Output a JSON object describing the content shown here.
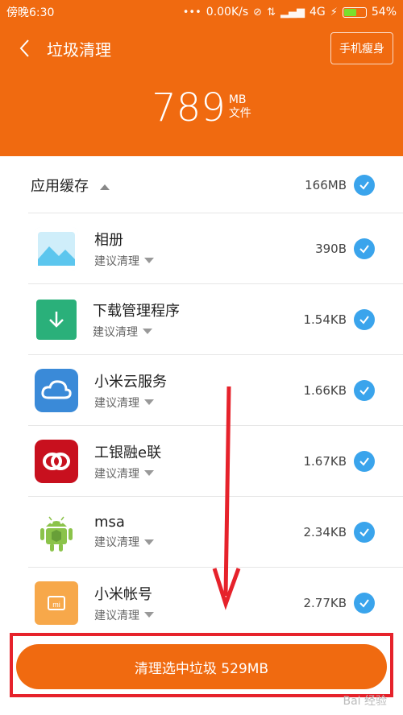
{
  "statusbar": {
    "time": "傍晚6:30",
    "network_speed": "0.00K/s",
    "signal_label": "4G",
    "battery_pct": "54%"
  },
  "nav": {
    "title": "垃圾清理",
    "slim_button": "手机瘦身"
  },
  "summary": {
    "total": "789",
    "unit": "MB",
    "unit_sub": "文件"
  },
  "group": {
    "label": "应用缓存",
    "size": "166MB"
  },
  "apps": [
    {
      "name": "相册",
      "sub": "建议清理",
      "size": "390B",
      "icon": "gallery-icon"
    },
    {
      "name": "下载管理程序",
      "sub": "建议清理",
      "size": "1.54KB",
      "icon": "download-icon"
    },
    {
      "name": "小米云服务",
      "sub": "建议清理",
      "size": "1.66KB",
      "icon": "cloud-icon"
    },
    {
      "name": "工银融e联",
      "sub": "建议清理",
      "size": "1.67KB",
      "icon": "icbc-icon"
    },
    {
      "name": "msa",
      "sub": "建议清理",
      "size": "2.34KB",
      "icon": "android-icon"
    },
    {
      "name": "小米帐号",
      "sub": "建议清理",
      "size": "2.77KB",
      "icon": "mi-account-icon"
    }
  ],
  "footer": {
    "clean_button": "清理选中垃圾 529MB"
  },
  "watermark": "Bai 经验",
  "colors": {
    "accent": "#f06a10",
    "check": "#3aa4ec",
    "highlight": "#e6222b"
  }
}
